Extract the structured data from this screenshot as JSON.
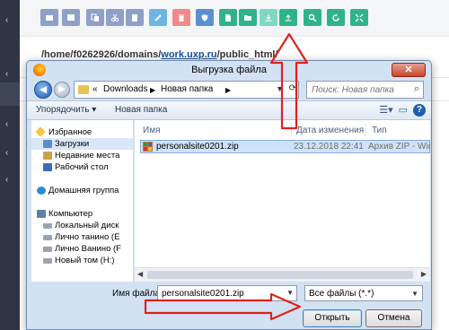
{
  "page": {
    "path_prefix": "/home/f0262926/domains/",
    "path_link": "work.uxp.ru",
    "path_suffix": "/public_html/"
  },
  "toolbar": {
    "buttons": [
      {
        "name": "upload-to-server-button",
        "color": "#7ed9c2",
        "icon": "upload-icon"
      },
      {
        "name": "download-button",
        "color": "#2fb489",
        "icon": "download-icon"
      }
    ]
  },
  "dialog": {
    "title": "Выгрузка файла",
    "close_label": "✕",
    "address": {
      "overflow": "«",
      "crumbs": [
        "Downloads",
        "Новая папка"
      ]
    },
    "search_placeholder": "Поиск: Новая папка",
    "commands": {
      "organize": "Упорядочить ▾",
      "new_folder": "Новая папка"
    },
    "nav": {
      "favorites": "Избранное",
      "downloads": "Загрузки",
      "recent": "Недавние места",
      "desktop": "Рабочий стол",
      "homegroup": "Домашняя группа",
      "computer": "Компьютер",
      "local_disk": "Локальный диск",
      "drive_e": "Лично танино (E",
      "drive_f": "Лично Ванино (F",
      "drive_h": "Новый том (H:)"
    },
    "columns": {
      "name": "Имя",
      "date": "Дата изменения",
      "type": "Тип"
    },
    "file": {
      "name": "personalsite0201.zip",
      "date": "23.12.2018 22:41",
      "type": "Архив ZIP - Winl"
    },
    "filename_label": "Имя файла:",
    "filename_value": "personalsite0201.zip",
    "filter": "Все файлы (*.*)",
    "open_label": "Открыть",
    "cancel_label": "Отмена"
  },
  "annotation_color": "#e0211d"
}
